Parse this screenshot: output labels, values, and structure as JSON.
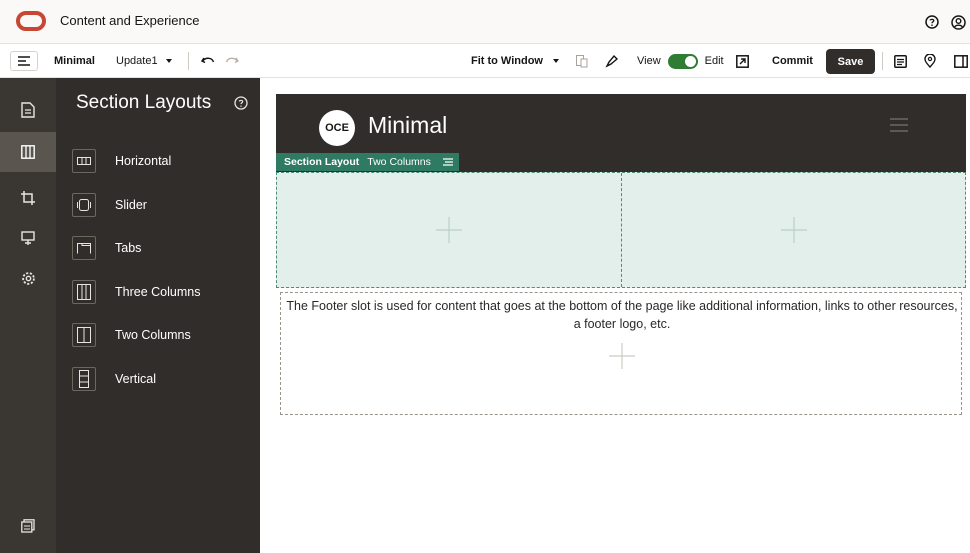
{
  "app": {
    "title": "Content and Experience"
  },
  "toolbar": {
    "site_name": "Minimal",
    "update_name": "Update1",
    "zoom_label": "Fit to Window",
    "view_label": "View",
    "edit_label": "Edit",
    "commit_label": "Commit",
    "save_label": "Save"
  },
  "panel": {
    "title": "Section Layouts",
    "items": [
      {
        "label": "Horizontal",
        "icon": "horizontal-layout-icon"
      },
      {
        "label": "Slider",
        "icon": "slider-layout-icon"
      },
      {
        "label": "Tabs",
        "icon": "tabs-layout-icon"
      },
      {
        "label": "Three Columns",
        "icon": "three-columns-layout-icon"
      },
      {
        "label": "Two Columns",
        "icon": "two-columns-layout-icon"
      },
      {
        "label": "Vertical",
        "icon": "vertical-layout-icon"
      }
    ]
  },
  "canvas": {
    "logo_text": "OCE",
    "site_title": "Minimal",
    "section_tag_prefix": "Section Layout",
    "section_tag_name": "Two Columns",
    "footer_text": "The Footer slot is used for content that goes at the bottom of the page like additional information, links to other resources, a footer logo, etc."
  },
  "colors": {
    "brand_red": "#c74634",
    "dark_panel": "#312d2a",
    "section_green": "#2e7a62",
    "section_fill": "#e2efea",
    "toggle_green": "#2e7d32"
  }
}
